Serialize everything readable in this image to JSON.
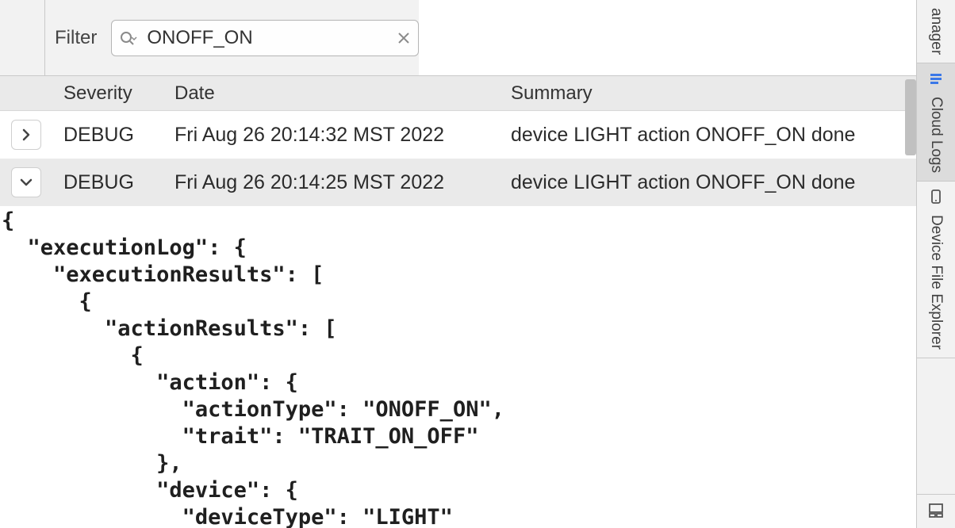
{
  "filter": {
    "label": "Filter",
    "value": "ONOFF_ON"
  },
  "columns": {
    "severity": "Severity",
    "date": "Date",
    "summary": "Summary"
  },
  "rows": [
    {
      "expanded": false,
      "severity": "DEBUG",
      "date": "Fri Aug 26 20:14:32 MST 2022",
      "summary": "device LIGHT action ONOFF_ON done"
    },
    {
      "expanded": true,
      "severity": "DEBUG",
      "date": "Fri Aug 26 20:14:25 MST 2022",
      "summary": "device LIGHT action ONOFF_ON done"
    }
  ],
  "json_body": "{\n  \"executionLog\": {\n    \"executionResults\": [\n      {\n        \"actionResults\": [\n          {\n            \"action\": {\n              \"actionType\": \"ONOFF_ON\",\n              \"trait\": \"TRAIT_ON_OFF\"\n            },\n            \"device\": {\n              \"deviceType\": \"LIGHT\"",
  "side_tabs": {
    "top_partial": "anager",
    "cloud_logs": "Cloud Logs",
    "file_explorer": "Device File Explorer"
  }
}
